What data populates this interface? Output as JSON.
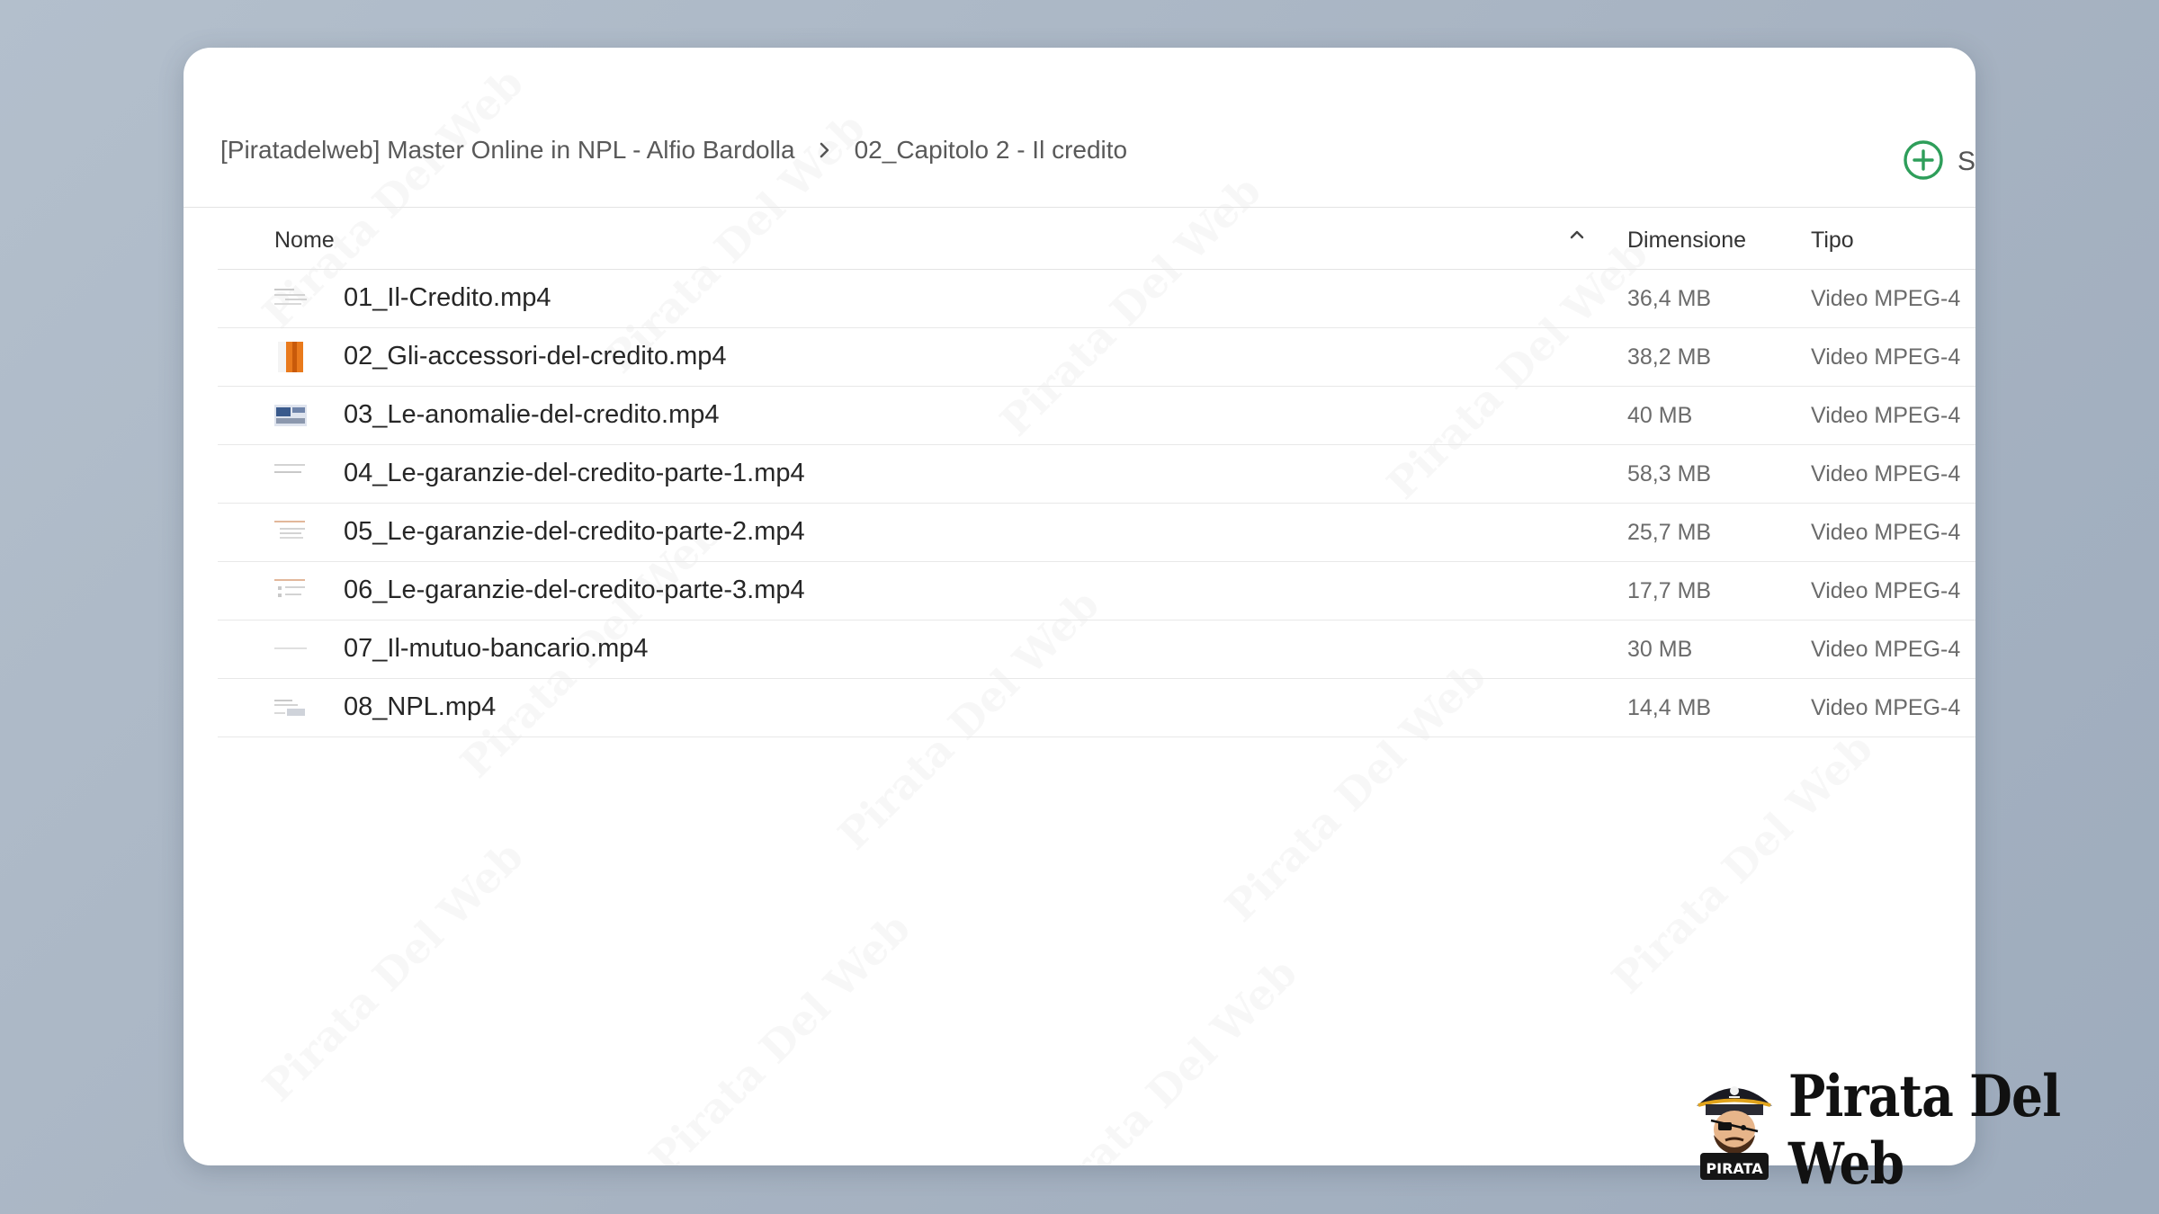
{
  "breadcrumb": {
    "items": [
      {
        "label": "[Piratadelweb] Master Online in NPL - Alfio Bardolla"
      },
      {
        "label": "02_Capitolo 2 - Il credito"
      }
    ]
  },
  "toolbar": {
    "new_label": "S",
    "accent_color": "#2e9e5a"
  },
  "columns": {
    "name": "Nome",
    "size": "Dimensione",
    "type": "Tipo",
    "sort_direction": "ascending"
  },
  "files": [
    {
      "name": "01_Il-Credito.mp4",
      "size": "36,4 MB",
      "type": "Video MPEG-4",
      "thumb": "slide-thumbnail"
    },
    {
      "name": "02_Gli-accessori-del-credito.mp4",
      "size": "38,2 MB",
      "type": "Video MPEG-4",
      "thumb": "orange-cover-thumbnail"
    },
    {
      "name": "03_Le-anomalie-del-credito.mp4",
      "size": "40 MB",
      "type": "Video MPEG-4",
      "thumb": "photo-thumbnail"
    },
    {
      "name": "04_Le-garanzie-del-credito-parte-1.mp4",
      "size": "58,3 MB",
      "type": "Video MPEG-4",
      "thumb": "slide-thumbnail"
    },
    {
      "name": "05_Le-garanzie-del-credito-parte-2.mp4",
      "size": "25,7 MB",
      "type": "Video MPEG-4",
      "thumb": "slide-thumbnail"
    },
    {
      "name": "06_Le-garanzie-del-credito-parte-3.mp4",
      "size": "17,7 MB",
      "type": "Video MPEG-4",
      "thumb": "slide-thumbnail"
    },
    {
      "name": "07_Il-mutuo-bancario.mp4",
      "size": "30 MB",
      "type": "Video MPEG-4",
      "thumb": "blank-thumbnail"
    },
    {
      "name": "08_NPL.mp4",
      "size": "14,4 MB",
      "type": "Video MPEG-4",
      "thumb": "slide-thumbnail"
    }
  ],
  "watermark": {
    "text": "Pirata Del Web"
  },
  "logo": {
    "text": "Pirata Del Web",
    "badge": "PIRATA"
  }
}
